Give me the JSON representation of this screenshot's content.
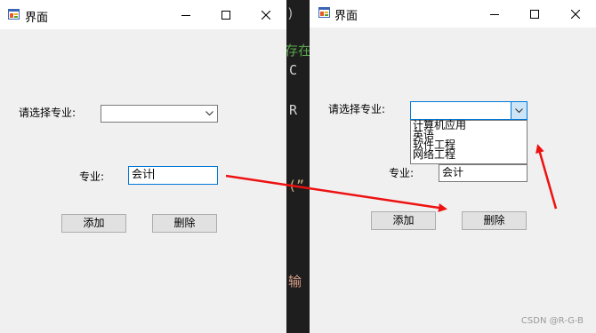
{
  "editor": {
    "glyphs": [
      {
        "text": ")",
        "color": "#b4b4b4"
      },
      {
        "text": "存在",
        "color": "#57a64a"
      },
      {
        "text": ".C",
        "color": "#d4d4d4"
      },
      {
        "text": ".R",
        "color": "#d4d4d4"
      },
      {
        "text": "(”",
        "color": "#d6b58a"
      },
      {
        "text": "输",
        "color": "#d69d85"
      }
    ]
  },
  "window_left": {
    "title": "界面",
    "major_label": "请选择专业:",
    "combo_value": "",
    "field_label": "专业:",
    "field_value": "会计",
    "add_label": "添加",
    "delete_label": "删除"
  },
  "window_right": {
    "title": "界面",
    "major_label": "请选择专业:",
    "combo_value": "",
    "options": [
      "计算机应用",
      "英语",
      "软件工程",
      "网络工程"
    ],
    "field_label": "专业:",
    "field_value": "会计",
    "add_label": "添加",
    "delete_label": "删除"
  },
  "annotation_color": "#ee1111",
  "watermark": "CSDN @R-G-B"
}
